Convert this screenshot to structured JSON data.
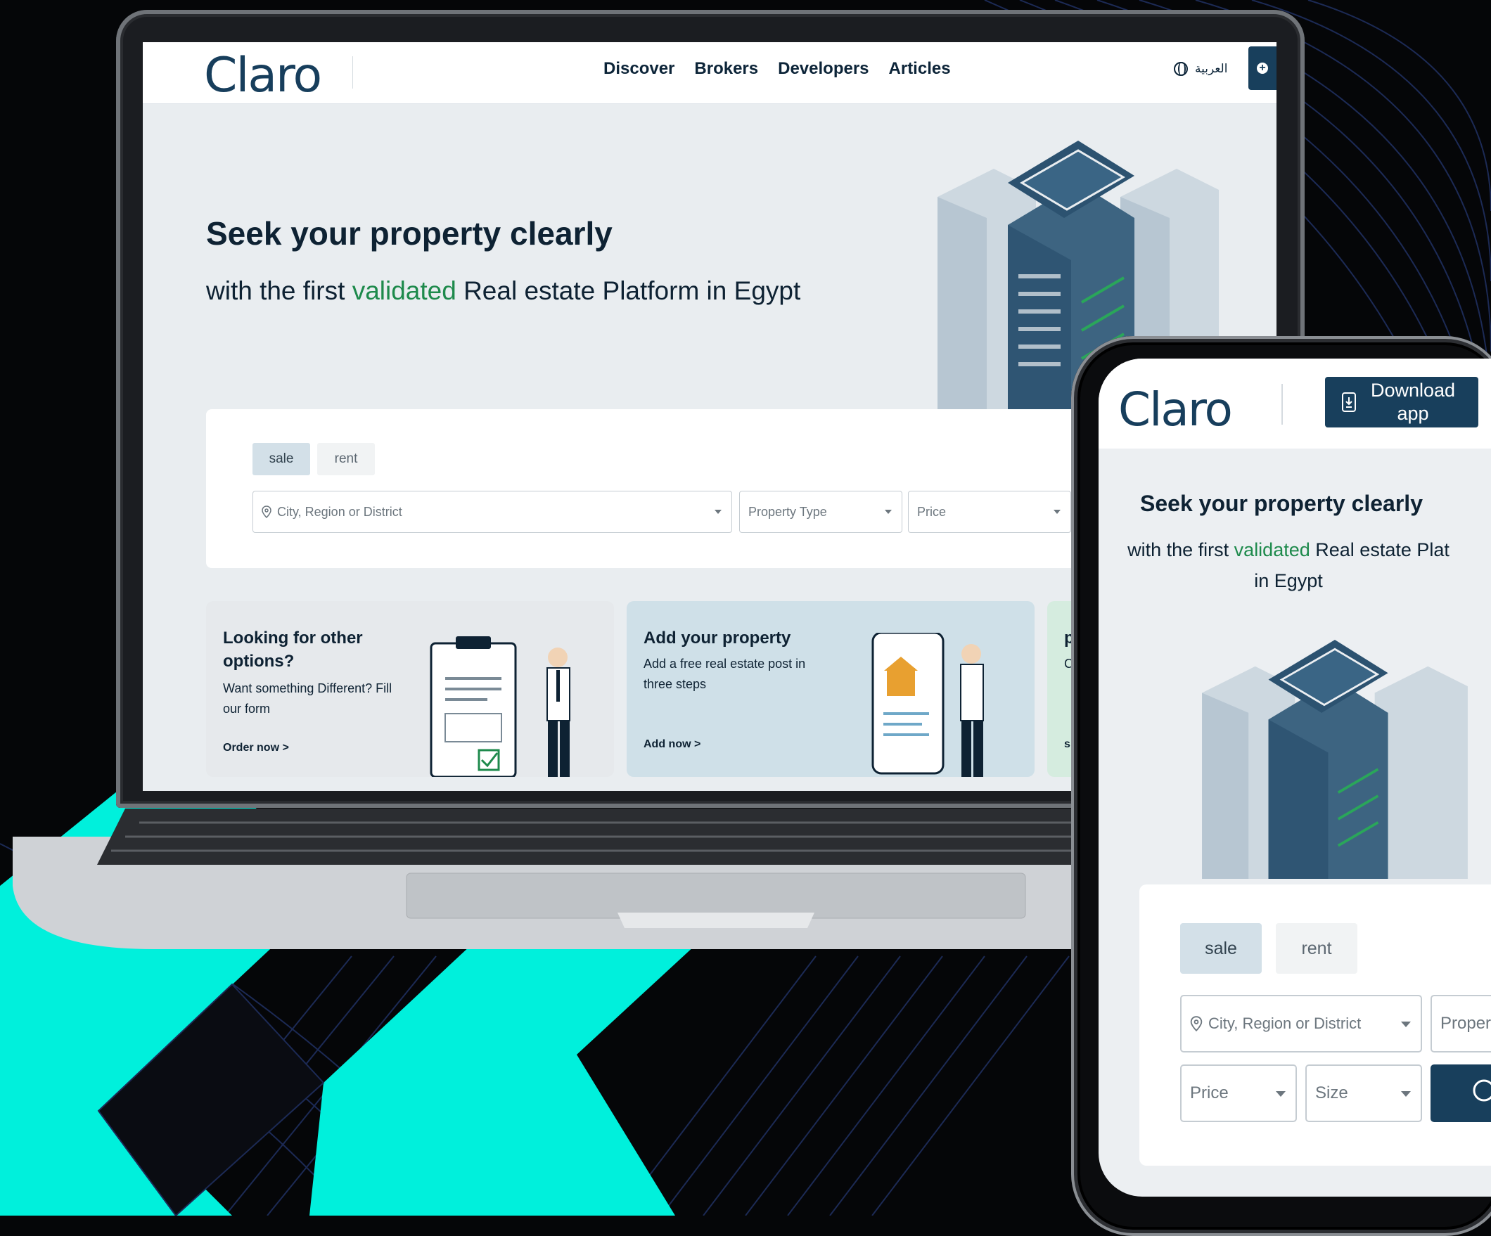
{
  "desktop": {
    "logo": "Claro",
    "nav": [
      "Discover",
      "Brokers",
      "Developers",
      "Articles"
    ],
    "language": "العربية",
    "hero": {
      "title": "Seek your property clearly",
      "sub_before": "with the first",
      "sub_highlight": "validated",
      "sub_after": "Real estate Platform in Egypt"
    },
    "search": {
      "tabs": [
        "sale",
        "rent"
      ],
      "city_placeholder": "City, Region or District",
      "type_placeholder": "Property Type",
      "price_placeholder": "Price"
    },
    "cards": [
      {
        "title": "Looking for other options?",
        "text": "Want something Different? Fill our form",
        "link": "Order now >"
      },
      {
        "title": "Add your property",
        "text": "Add a free real estate post in three steps",
        "link": "Add now >"
      },
      {
        "title": "p",
        "text": "C",
        "link": "s"
      }
    ]
  },
  "mobile": {
    "logo": "Claro",
    "download": "Download app",
    "hero": {
      "title": "Seek your property clearly",
      "sub_before": "with the first",
      "sub_highlight": "validated",
      "sub_after": "Real estate Plat",
      "sub_line2": "in Egypt"
    },
    "search": {
      "tabs": [
        "sale",
        "rent"
      ],
      "city_placeholder": "City, Region or District",
      "type_placeholder": "Property ...",
      "price_placeholder": "Price",
      "size_placeholder": "Size"
    }
  },
  "colors": {
    "brand": "#183f5c",
    "accent_green": "#1e8a4c",
    "cyan": "#00f0dc"
  }
}
